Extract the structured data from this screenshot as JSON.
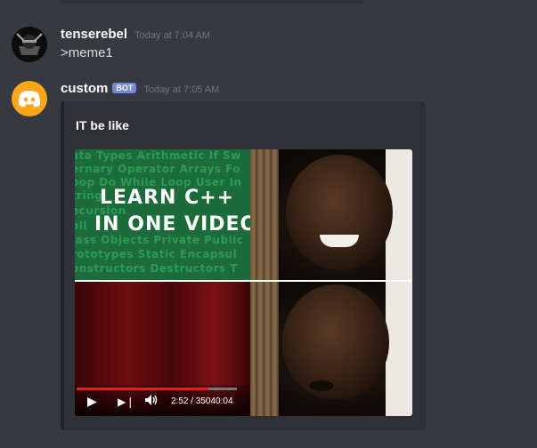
{
  "messages": [
    {
      "username": "tenserebel",
      "timestamp": "Today at 7:04 AM",
      "content": ">meme1"
    },
    {
      "username": "custom",
      "bot_tag": "BOT",
      "timestamp": "Today at 7:05 AM",
      "embed": {
        "title": "IT be like",
        "close_symbol": "×",
        "image": {
          "code_lines": [
            "ata Types Arithmetic If Sw",
            "ernary Operator Arrays Fo",
            "oop Do While Loop User In",
            "tring",
            "ecursion",
            "oll",
            "lass Objects Private Public",
            "rototypes Static Encapsul",
            "onstructors Destructors T"
          ],
          "headline_1": "LEARN C++",
          "headline_2": "IN ONE VIDEO",
          "video_time": "2:52 / 35040:04",
          "progress_fraction": 0.82
        }
      }
    }
  ],
  "colors": {
    "background": "#36393f",
    "embed_bg": "#2f3136",
    "bot_tag": "#7289da",
    "discord_avatar": "#faa61a"
  },
  "icons": {
    "close": "close-icon",
    "play": "play-icon",
    "next": "skip-next-icon",
    "volume": "volume-icon"
  }
}
